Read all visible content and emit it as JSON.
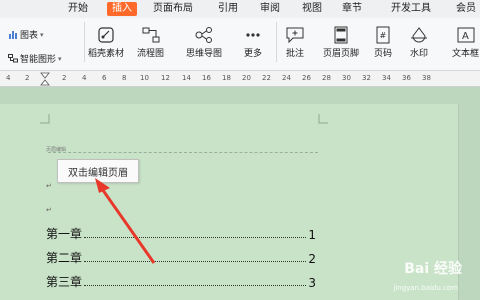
{
  "tabs": [
    "开始",
    "插入",
    "页面布局",
    "引用",
    "审阅",
    "视图",
    "章节",
    "开发工具",
    "会员"
  ],
  "active_tab": "插入",
  "ribbon": {
    "chart": "图表",
    "smart_shape": "智能图形",
    "shell_material": "稻壳素材",
    "flowchart": "流程图",
    "mindmap": "思维导图",
    "more": "更多",
    "comment": "批注",
    "header_footer": "页眉页脚",
    "page_number": "页码",
    "watermark": "水印",
    "textbox": "文本框"
  },
  "ruler_numbers": [
    "4",
    "2",
    "2",
    "4",
    "6",
    "8",
    "10",
    "12",
    "14",
    "16",
    "18",
    "20",
    "22",
    "24",
    "26",
    "28",
    "30",
    "32",
    "34",
    "36",
    "38"
  ],
  "document": {
    "header_label": "页眉编辑",
    "tooltip": "双击编辑页眉",
    "toc": [
      {
        "title": "第一章",
        "page": "1"
      },
      {
        "title": "第二章",
        "page": "2"
      },
      {
        "title": "第三章",
        "page": "3"
      }
    ]
  },
  "watermark": {
    "main": "Bai 经验",
    "sub": "jingyan.baidu.com"
  },
  "colors": {
    "accent": "#ff6a2a",
    "page": "#c9e3c9",
    "arrow": "#e8382a"
  }
}
